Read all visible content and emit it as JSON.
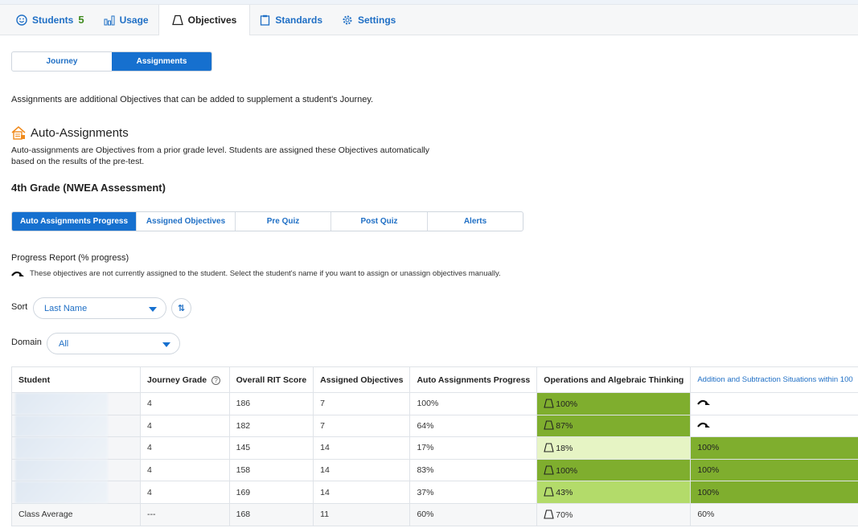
{
  "nav": {
    "tabs": [
      {
        "label": "Students",
        "count": "5",
        "icon": "smiley-icon"
      },
      {
        "label": "Usage",
        "icon": "bar-chart-icon"
      },
      {
        "label": "Objectives",
        "icon": "trapezoid-icon",
        "active": true
      },
      {
        "label": "Standards",
        "icon": "clipboard-icon"
      },
      {
        "label": "Settings",
        "icon": "gear-icon"
      }
    ]
  },
  "segment": {
    "journey": "Journey",
    "assignments": "Assignments",
    "active": "Assignments"
  },
  "intro_text": "Assignments are additional Objectives that can be added to supplement a student's Journey.",
  "auto_assignments": {
    "title": "Auto-Assignments",
    "description": "Auto-assignments are Objectives from a prior grade level. Students are assigned these Objectives automatically based on the results of the pre-test.",
    "grade_title": "4th Grade (NWEA Assessment)"
  },
  "subtabs": [
    "Auto Assignments Progress",
    "Assigned Objectives",
    "Pre Quiz",
    "Post Quiz",
    "Alerts"
  ],
  "progress_report": {
    "title": "Progress Report (% progress)",
    "note": "These objectives are not currently assigned to the student. Select the student's name if you want to assign or unassign objectives manually."
  },
  "sort": {
    "label": "Sort",
    "value": "Last Name"
  },
  "domain": {
    "label": "Domain",
    "value": "All"
  },
  "table": {
    "headers": [
      "Student",
      "Journey Grade",
      "Overall RIT Score",
      "Assigned Objectives",
      "Auto Assignments Progress",
      "Operations and Algebraic Thinking",
      "Addition and Subtraction Situations within 100"
    ],
    "rows": [
      {
        "grade": "4",
        "rit": "186",
        "assigned": "7",
        "progress": "100%",
        "oat": "100%",
        "oat_level": "dark",
        "addsub": "",
        "addsub_level": "unassigned"
      },
      {
        "grade": "4",
        "rit": "182",
        "assigned": "7",
        "progress": "64%",
        "oat": "87%",
        "oat_level": "dark",
        "addsub": "",
        "addsub_level": "unassigned"
      },
      {
        "grade": "4",
        "rit": "145",
        "assigned": "14",
        "progress": "17%",
        "oat": "18%",
        "oat_level": "light",
        "addsub": "100%",
        "addsub_level": "dark"
      },
      {
        "grade": "4",
        "rit": "158",
        "assigned": "14",
        "progress": "83%",
        "oat": "100%",
        "oat_level": "dark",
        "addsub": "100%",
        "addsub_level": "dark"
      },
      {
        "grade": "4",
        "rit": "169",
        "assigned": "14",
        "progress": "37%",
        "oat": "43%",
        "oat_level": "mid",
        "addsub": "100%",
        "addsub_level": "dark"
      }
    ],
    "average": {
      "label": "Class Average",
      "grade": "---",
      "rit": "168",
      "assigned": "11",
      "progress": "60%",
      "oat": "70%",
      "addsub": "60%"
    }
  },
  "colors": {
    "accent": "#1670cf",
    "progress_dark": "#7fae2e",
    "progress_mid": "#b3db6a",
    "progress_light": "#e6f4c4"
  }
}
